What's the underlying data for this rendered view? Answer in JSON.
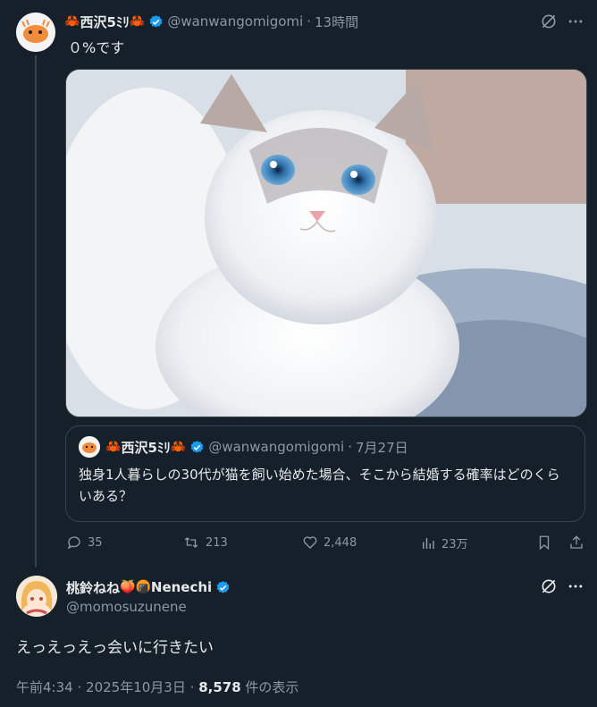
{
  "colors": {
    "background": "#15202b",
    "text": "#e7e9ea",
    "muted": "#8b98a5",
    "border": "#38444d",
    "verified": "#1d9bf0"
  },
  "tweet": {
    "display_name": "西沢5ﾐﾘ",
    "name_emoji_left": "🦀",
    "name_emoji_right": "🦀",
    "handle": "@wanwangomigomi",
    "separator": "·",
    "time": "13時間",
    "text": "０%です",
    "quote": {
      "display_name": "西沢5ﾐﾘ",
      "name_emoji_left": "🦀",
      "name_emoji_right": "🦀",
      "handle": "@wanwangomigomi",
      "separator": "·",
      "date": "7月27日",
      "text": "独身1人暮らしの30代が猫を飼い始めた場合、そこから結婚する確率はどのくらいある？"
    },
    "actions": {
      "replies": "35",
      "retweets": "213",
      "likes": "2,448",
      "views": "23万"
    }
  },
  "reply": {
    "display_name_text": "桃鈴ねね",
    "emoji1": "🍑",
    "emoji2": "🍘",
    "display_name_suffix": "Nenechi",
    "handle": "@momosuzunene",
    "text": "えっえっえっ会いに行きたい",
    "meta_time": "午前4:34",
    "meta_sep1": "·",
    "meta_date": "2025年10月3日",
    "meta_sep2": "·",
    "meta_views": "8,578",
    "meta_views_label": "件の表示"
  },
  "icons": [
    "grok-icon",
    "more-icon",
    "reply-icon",
    "retweet-icon",
    "like-icon",
    "views-icon",
    "bookmark-icon",
    "share-icon",
    "verified-icon"
  ]
}
